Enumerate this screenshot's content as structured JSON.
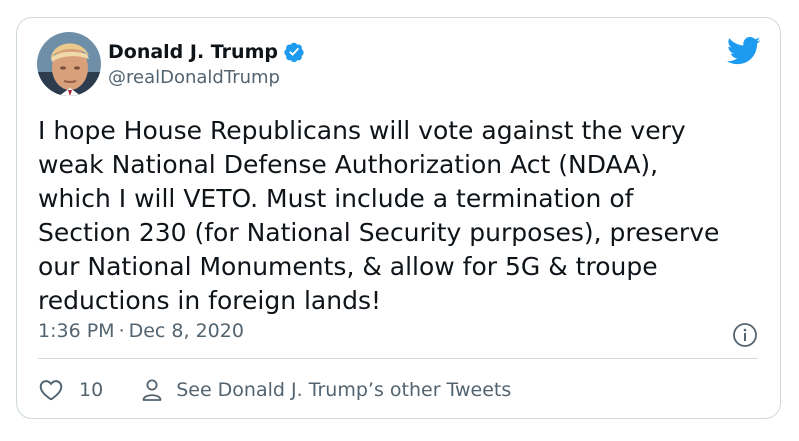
{
  "user": {
    "display_name": "Donald J. Trump",
    "handle": "@realDonaldTrump",
    "verified": true
  },
  "tweet": {
    "text": "I hope House Republicans will vote against the very\nweak National Defense Authorization Act (NDAA),\nwhich I will VETO. Must include a termination of\nSection 230 (for National Security purposes), preserve\nour National Monuments, & allow for 5G & troupe\nreductions in foreign lands!",
    "time": "1:36 PM",
    "separator": "·",
    "date": "Dec 8, 2020"
  },
  "actions": {
    "like_count": "10",
    "other_tweets_label": "See Donald J. Trump’s other Tweets"
  },
  "icons": {
    "verified": "verified-badge-icon",
    "brand": "twitter-bird-icon",
    "info": "info-icon",
    "like": "heart-icon",
    "profile": "person-icon"
  },
  "colors": {
    "brand_blue": "#1d9bf0",
    "text_primary": "#0f1419",
    "text_secondary": "#536471",
    "border": "#cfd9de"
  }
}
